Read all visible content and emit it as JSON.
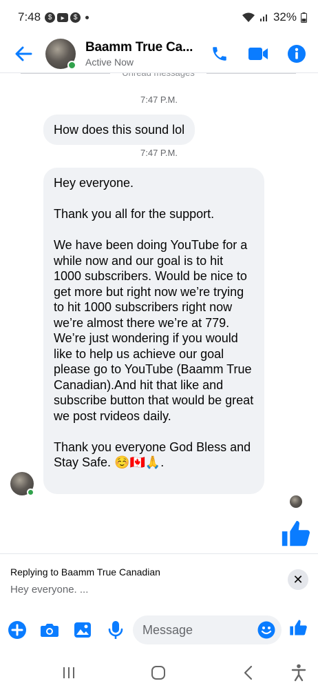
{
  "status_bar": {
    "time": "7:48",
    "battery": "32%"
  },
  "header": {
    "title": "Baamm True Ca...",
    "status": "Active Now",
    "back_icon": "arrow-left-icon",
    "actions": [
      "phone-icon",
      "video-camera-icon",
      "info-icon"
    ],
    "accent_color": "#0a7cff"
  },
  "messages": {
    "divider_label": "Unread messages",
    "timestamp_1": "7:47 P.M.",
    "bubble_1": "How does this sound lol",
    "timestamp_2": "7:47 P.M.",
    "bubble_2": "Hey everyone.\n\nThank you all for the support.\n\nWe have been doing YouTube for a while now and our goal is to hit 1000 subscribers. Would be nice to get more but right now we’re trying to hit 1000 subscribers right now we’re almost there we’re at 779. We’re just wondering if you would like to help us achieve our goal please go to YouTube (Baamm True Canadian).And hit that like and subscribe button that would be great we post rvideos daily.\n\nThank you everyone God Bless and Stay Safe. ",
    "bubble_2_emoji": "☺️🇨🇦🙏.",
    "big_like_icon": "thumbs-up-icon"
  },
  "reply": {
    "title": "Replying to Baamm True Canadian",
    "preview": "Hey everyone. ...",
    "close_icon": "close-icon"
  },
  "composer": {
    "placeholder": "Message",
    "icons": [
      "plus-icon",
      "camera-icon",
      "gallery-icon",
      "microphone-icon",
      "emoji-icon",
      "thumbs-up-icon"
    ]
  },
  "nav": {
    "icons": [
      "recent-apps-icon",
      "home-icon",
      "back-icon",
      "accessibility-icon"
    ]
  }
}
